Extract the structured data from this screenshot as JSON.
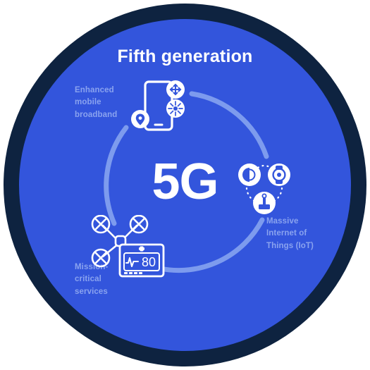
{
  "graphic": {
    "type": "concentric-circle-infographic",
    "title": "Fifth generation",
    "center_label": "5G",
    "colors": {
      "outer_ring": "#0e2340",
      "inner_disc": "#3355dc",
      "arc": "#7d9bee",
      "title_text": "#ffffff",
      "center_text": "#ffffff",
      "label_text": "#8aa3ef",
      "icon": "#ffffff",
      "background": "#ffffff"
    }
  },
  "pillars": [
    {
      "id": "enhanced-mobile-broadband",
      "label_lines": [
        "Enhanced",
        "mobile",
        "broadband"
      ],
      "label": "Enhanced mobile broadband",
      "icons": [
        "smartphone-icon",
        "move-arrows-icon",
        "sunburst-icon",
        "location-pin-icon"
      ]
    },
    {
      "id": "massive-internet-of-things",
      "label_lines": [
        "Massive",
        "Internet of",
        "Things (IoT)"
      ],
      "label": "Massive Internet of Things (IoT)",
      "icons": [
        "speaker-icon",
        "smartwatch-icon",
        "sensor-antenna-icon"
      ]
    },
    {
      "id": "mission-critical-services",
      "label_lines": [
        "Mission-",
        "critical",
        "services"
      ],
      "label": "Mission-critical services",
      "icons": [
        "drone-icon",
        "vital-signs-monitor-icon",
        "medical-cross-icon"
      ]
    }
  ],
  "monitor": {
    "reading": "80"
  }
}
